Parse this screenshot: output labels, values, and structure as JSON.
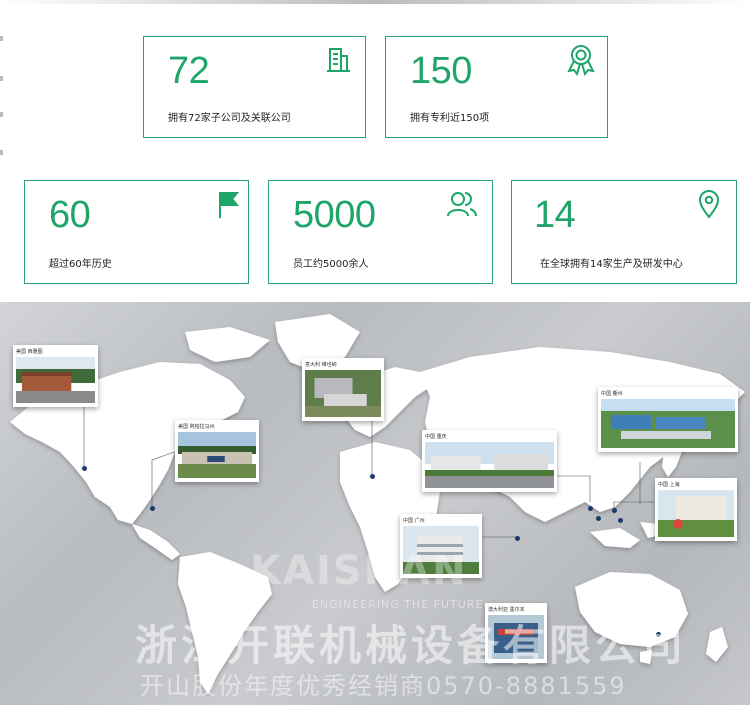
{
  "stats": [
    {
      "number": "72",
      "label": "拥有72家子公司及关联公司",
      "icon": "building-icon"
    },
    {
      "number": "150",
      "label": "拥有专利近150项",
      "icon": "award-icon"
    },
    {
      "number": "60",
      "label": "超过60年历史",
      "icon": "flag-icon"
    },
    {
      "number": "5000",
      "label": "员工约5000余人",
      "icon": "users-icon"
    },
    {
      "number": "14",
      "label": "在全球拥有14家生产及研发中心",
      "icon": "location-pin-icon"
    }
  ],
  "locations": [
    {
      "caption": "美国 西雅图"
    },
    {
      "caption": "美国 阿帕拉马州"
    },
    {
      "caption": "意大利 维也纳"
    },
    {
      "caption": "中国 重庆"
    },
    {
      "caption": "中国 衢州"
    },
    {
      "caption": "中国 上海"
    },
    {
      "caption": "中国 广州"
    },
    {
      "caption": "澳大利亚 墨尔本"
    }
  ],
  "watermark": {
    "logo_text": "KAISHAN",
    "logo_sub": "ENGINEERING THE FUTURE",
    "company": "浙江开联机械设备有限公司",
    "dealer": "开山股份年度优秀经销商0570-8881559"
  },
  "colors": {
    "accent": "#1fa46a",
    "border": "#27a36b",
    "map_bg": "#c4c6c9",
    "dot": "#1b3a6b"
  }
}
